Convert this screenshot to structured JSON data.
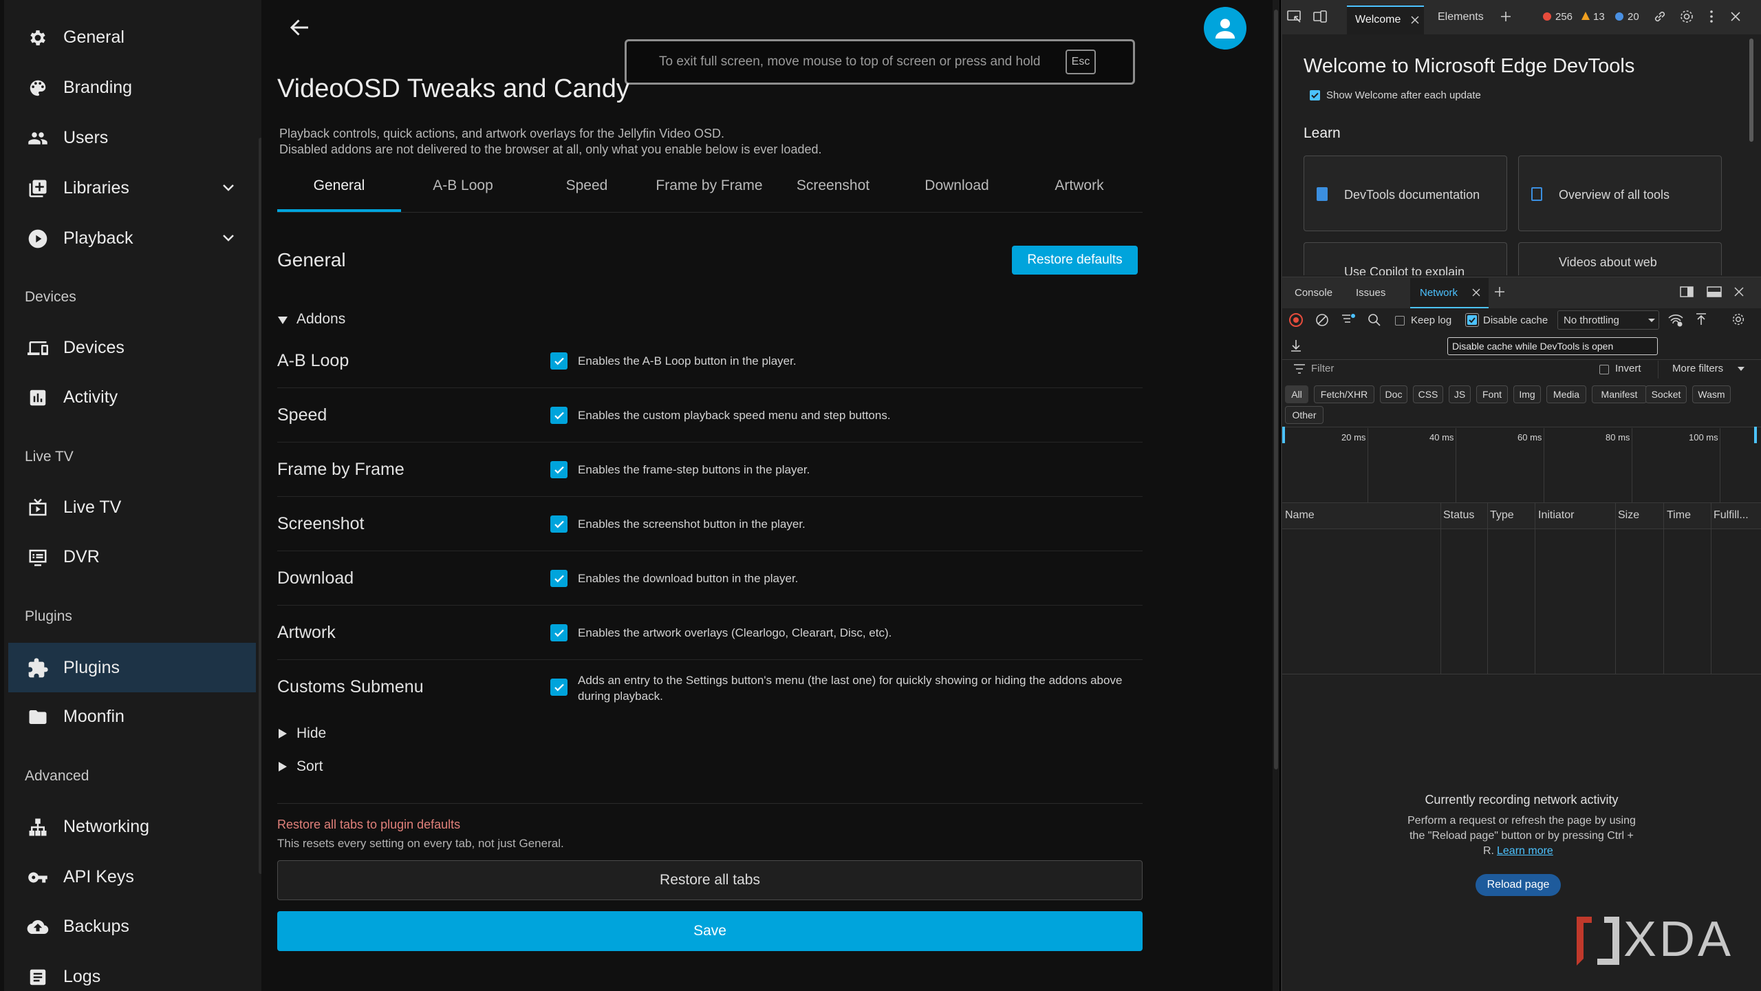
{
  "sidebar": {
    "items": [
      {
        "label": "General",
        "icon": "gear-icon"
      },
      {
        "label": "Branding",
        "icon": "palette-icon"
      },
      {
        "label": "Users",
        "icon": "users-icon"
      },
      {
        "label": "Libraries",
        "icon": "library-add-icon"
      },
      {
        "label": "Playback",
        "icon": "play-circle-icon"
      },
      {
        "label": "Devices",
        "icon": "devices-icon"
      },
      {
        "label": "Activity",
        "icon": "activity-chart-icon"
      },
      {
        "label": "Live TV",
        "icon": "live-tv-icon"
      },
      {
        "label": "DVR",
        "icon": "dvr-icon"
      },
      {
        "label": "Plugins",
        "icon": "puzzle-icon"
      },
      {
        "label": "Moonfin",
        "icon": "folder-icon"
      },
      {
        "label": "Networking",
        "icon": "network-icon"
      },
      {
        "label": "API Keys",
        "icon": "key-icon"
      },
      {
        "label": "Backups",
        "icon": "cloud-upload-icon"
      },
      {
        "label": "Logs",
        "icon": "logs-icon"
      }
    ],
    "sections": [
      "Devices",
      "Live TV",
      "Plugins",
      "Advanced"
    ],
    "active": "Plugins"
  },
  "main": {
    "fullscreen_notice": "To exit full screen, move mouse to top of screen or press and hold",
    "esc_key": "Esc",
    "title": "VideoOSD Tweaks and Candy",
    "description_line1": "Playback controls, quick actions, and artwork overlays for the Jellyfin Video OSD.",
    "description_line2": "Disabled addons are not delivered to the browser at all, only what you enable below is ever loaded.",
    "tabs": [
      "General",
      "A-B Loop",
      "Speed",
      "Frame by Frame",
      "Screenshot",
      "Download",
      "Artwork"
    ],
    "active_tab": "General",
    "section_title": "General",
    "restore_defaults": "Restore defaults",
    "addons_label": "Addons",
    "addons": [
      {
        "name": "A-B Loop",
        "desc": "Enables the A-B Loop button in the player.",
        "checked": true
      },
      {
        "name": "Speed",
        "desc": "Enables the custom playback speed menu and step buttons.",
        "checked": true
      },
      {
        "name": "Frame by Frame",
        "desc": "Enables the frame-step buttons in the player.",
        "checked": true
      },
      {
        "name": "Screenshot",
        "desc": "Enables the screenshot button in the player.",
        "checked": true
      },
      {
        "name": "Download",
        "desc": "Enables the download button in the player.",
        "checked": true
      },
      {
        "name": "Artwork",
        "desc": "Enables the artwork overlays (Clearlogo, Clearart, Disc, etc).",
        "checked": true
      },
      {
        "name": "Customs Submenu",
        "desc_line1": "Adds an entry to the Settings button's menu (the last one) for quickly showing or hiding the addons above",
        "desc_line2": "during playback.",
        "checked": true
      }
    ],
    "hide_label": "Hide",
    "sort_label": "Sort",
    "restore_all_title": "Restore all tabs to plugin defaults",
    "restore_all_note": "This resets every setting on every tab, not just General.",
    "restore_all_button": "Restore all tabs",
    "save_button": "Save"
  },
  "devtools": {
    "tabs": [
      "Welcome",
      "Elements"
    ],
    "errors": "256",
    "warnings": "13",
    "info": "20",
    "welcome_title": "Welcome to Microsoft Edge DevTools",
    "show_welcome": "Show Welcome after each update",
    "learn": "Learn",
    "cards": [
      "DevTools documentation",
      "Overview of all tools",
      "Use Copilot to explain",
      "Videos about web"
    ],
    "drawer_tabs": [
      "Console",
      "Issues",
      "Network"
    ],
    "keep_log": "Keep log",
    "disable_cache": "Disable cache",
    "throttling": "No throttling",
    "tooltip": "Disable cache while DevTools is open",
    "filter_placeholder": "Filter",
    "invert": "Invert",
    "more_filters": "More filters",
    "chips": [
      "All",
      "Fetch/XHR",
      "Doc",
      "CSS",
      "JS",
      "Font",
      "Img",
      "Media",
      "Manifest",
      "Socket",
      "Wasm",
      "Other"
    ],
    "timeline": [
      "20 ms",
      "40 ms",
      "60 ms",
      "80 ms",
      "100 ms"
    ],
    "columns": [
      "Name",
      "Status",
      "Type",
      "Initiator",
      "Size",
      "Time",
      "Fulfill..."
    ],
    "recording_title": "Currently recording network activity",
    "recording_line1": "Perform a request or refresh the page by using",
    "recording_line2": "the \"Reload page\" button or by pressing Ctrl +",
    "recording_line3": "R.",
    "learn_more": "Learn more",
    "reload_button": "Reload page"
  },
  "watermark": "XDA",
  "colors": {
    "accent": "#00a4dc",
    "sidebar_active": "#1d3346",
    "edge_blue": "#0078d4"
  }
}
